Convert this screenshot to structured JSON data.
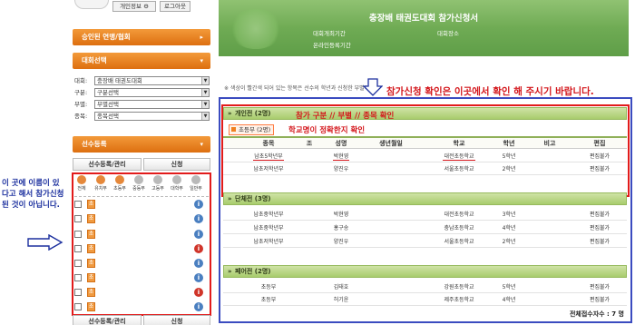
{
  "profile": {
    "info_btn": "개인정보 ⚙",
    "logout_btn": "로그아웃"
  },
  "sidebar": {
    "approved_label": "승인된 연맹/협회",
    "competition_select_label": "대회선택",
    "selects": [
      {
        "label": "대회:",
        "value": "충장배 태권도대회"
      },
      {
        "label": "구분:",
        "value": "구분선택"
      },
      {
        "label": "부별:",
        "value": "부별선택"
      },
      {
        "label": "종목:",
        "value": "종목선택"
      }
    ],
    "player_register_label": "선수등록",
    "tab_register": "선수등록/관리",
    "tab_apply": "신청",
    "categories": [
      "전체",
      "유치부",
      "초등부",
      "중등부",
      "고등부",
      "대학부",
      "일반부"
    ],
    "list_tag": "초",
    "info_icon": "i"
  },
  "annotation_left": "이 곳에 이름이 있다고 해서 참가신청 된 것이 아닙니다.",
  "header": {
    "title": "충장배 태권도대회 참가신청서",
    "period_label": "대회개최기간",
    "place_label": "대회장소",
    "online_period_label": "온라인등록기간"
  },
  "notice_text": "※ 색상이 빨간색 되어 있는 항목은 선수의 학년과 신청한 부별이 다",
  "big_note": "참가신청 확인은 이곳에서 확인 해 주시기 바랍니다.",
  "red_note_1": "참가 구분 // 부별 // 종목 확인",
  "red_note_2": "학교명이 정확한지 확인",
  "columns": [
    "종목",
    "조",
    "성명",
    "생년월일",
    "학교",
    "학년",
    "비고",
    "편집"
  ],
  "sections": [
    {
      "title": "개인전 (2명)",
      "division_tag": "초등부 (2명)",
      "rows": [
        {
          "event": "남초5학년부",
          "name": "박현영",
          "school": "대전초등학교",
          "grade": "5학년",
          "edit": "편집불가"
        },
        {
          "event": "남초저학년부",
          "name": "양진우",
          "school": "서울초등학교",
          "grade": "2학년",
          "edit": "편집불가"
        }
      ]
    },
    {
      "title": "단체전 (3명)",
      "rows": [
        {
          "event": "남초중학년부",
          "name": "박현영",
          "school": "대전초등학교",
          "grade": "3학년",
          "edit": "편집불가"
        },
        {
          "event": "남초중학년부",
          "name": "홍구송",
          "school": "충남초등학교",
          "grade": "4학년",
          "edit": "편집불가"
        },
        {
          "event": "남초저학년부",
          "name": "양진우",
          "school": "서울초등학교",
          "grade": "2학년",
          "edit": "편집불가"
        }
      ]
    },
    {
      "title": "페어전 (2명)",
      "rows": [
        {
          "event": "초등부",
          "name": "김태호",
          "school": "강원초등학교",
          "grade": "5학년",
          "edit": "편집불가"
        },
        {
          "event": "초등부",
          "name": "허기윤",
          "school": "제주초등학교",
          "grade": "4학년",
          "edit": "편집불가"
        }
      ]
    }
  ],
  "total": "전체접수자수 : 7 명"
}
